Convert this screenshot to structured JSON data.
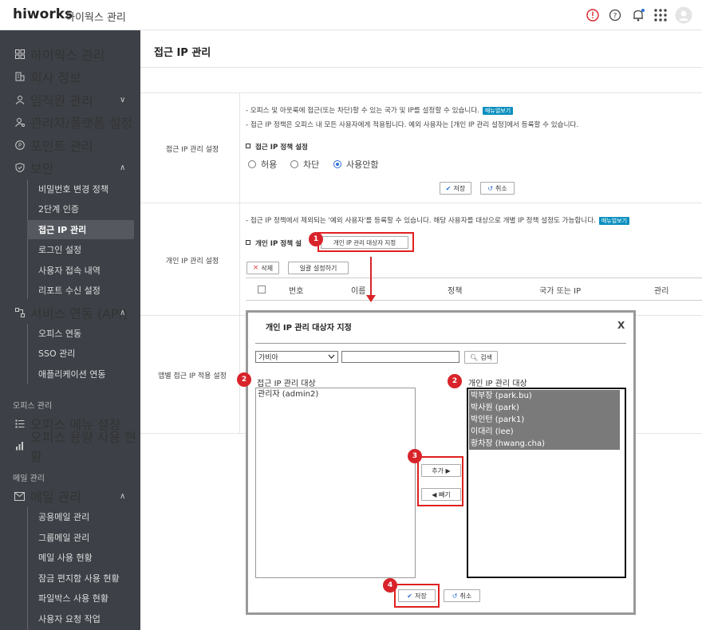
{
  "topbar": {
    "logo": "hiworks",
    "title": "하이웍스 관리"
  },
  "colors": {
    "sidebar_bg": "#3d4147",
    "accent": "#2d6fd3",
    "highlight": "#d8232a",
    "menu_btn": "#0a8fbf"
  },
  "sidebar": {
    "items": [
      {
        "label": "하이웍스 관리",
        "icon": "grid-icon"
      },
      {
        "label": "회사 정보",
        "icon": "building-icon"
      },
      {
        "label": "임직원 관리",
        "icon": "user-icon"
      },
      {
        "label": "관리자/플랫폼 설정",
        "icon": "user-gear-icon"
      },
      {
        "label": "포인트 관리",
        "icon": "point-icon"
      },
      {
        "label": "보안",
        "icon": "shield-icon"
      },
      {
        "label": "서비스 연동 (API)",
        "icon": "api-icon"
      }
    ],
    "security_sub": [
      "비밀번호 변경 정책",
      "2단계 인증",
      "접근 IP 관리",
      "로그인 설정",
      "사용자 접속 내역",
      "리포트 수신 설정"
    ],
    "api_sub": [
      "오피스 연동",
      "SSO 관리",
      "애플리케이션 연동"
    ],
    "office_head": "오피스 관리",
    "office_items": [
      {
        "label": "오피스 메뉴 설정",
        "icon": "list-icon"
      },
      {
        "label": "오피스 용량 사용 현황",
        "icon": "bar-chart-icon"
      }
    ],
    "mail_head": "메일 관리",
    "mail_item": {
      "label": "메일 관리",
      "icon": "mail-icon"
    },
    "mail_sub": [
      "공용메일 관리",
      "그룹메일 관리",
      "메일 사용 현황",
      "잠금 편지함 사용 현황",
      "파일박스 사용 현황",
      "사용자 요청 작업"
    ]
  },
  "main": {
    "title": "접근 IP 관리",
    "sections": {
      "access": {
        "label": "접근 IP 관리 설정",
        "desc1": "- 오피스 및 아웃룩에 접근(또는 차단)할 수 있는 국가 및 IP를 설정할 수 있습니다.",
        "desc2": "- 접근 IP 정책은 오피스 내 모든 사용자에게 적용됩니다. 예외 사용자는 [개인 IP 관리 설정]에서 등록할 수 있습니다.",
        "menu_btn": "매뉴얼보기",
        "policy_title": "접근 IP 정책 설정",
        "radios": [
          {
            "label": "허용",
            "checked": false
          },
          {
            "label": "차단",
            "checked": false
          },
          {
            "label": "사용안함",
            "checked": true
          }
        ],
        "save": "저장",
        "cancel": "취소"
      },
      "personal": {
        "label": "개인 IP 관리 설정",
        "desc": "- 접근 IP 정책에서 제외되는 '예외 사용자'를 등록할 수 있습니다. 해당 사용자를 대상으로 개별 IP 정책 설정도 가능합니다.",
        "menu_btn": "매뉴얼보기",
        "policy_title": "개인 IP 정책 설",
        "assign_btn": "개인 IP 관리 대상자 지정",
        "delete_btn": "삭제",
        "bulk_btn": "일괄 설정하기",
        "columns": [
          "번호",
          "이름",
          "정책",
          "국가 또는 IP",
          "관리"
        ]
      },
      "app": {
        "label": "앱별 접근 IP 적용 설정"
      }
    }
  },
  "modal": {
    "title": "개인 IP 관리 대상자 지정",
    "close": "X",
    "country": "가비아",
    "search_btn": "검색",
    "left_title": "접근 IP 관리 대상",
    "left_items": [
      "관리자 (admin2)"
    ],
    "right_title": "개인 IP 관리 대상",
    "right_items": [
      "박부장 (park.bu)",
      "박사원 (park)",
      "박인턴 (park1)",
      "이대리 (lee)",
      "황차장 (hwang.cha)"
    ],
    "add_btn": "추가 ▶",
    "remove_btn": "◀ 빼기",
    "save": "저장",
    "cancel": "취소"
  },
  "badges": [
    "1",
    "2",
    "2",
    "3",
    "4"
  ]
}
